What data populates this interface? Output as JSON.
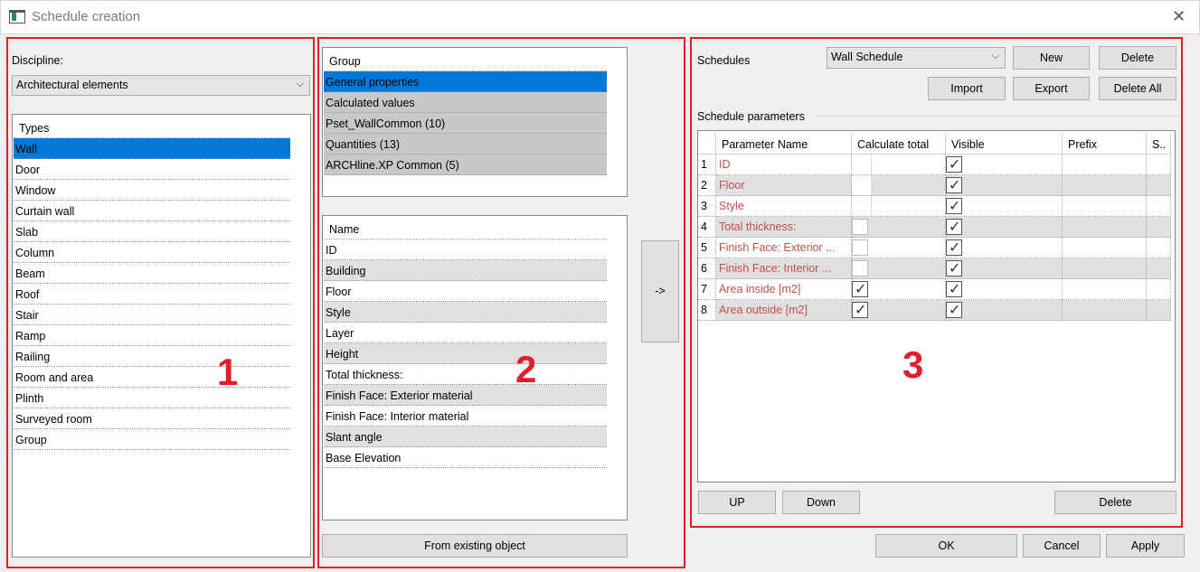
{
  "window": {
    "title": "Schedule creation"
  },
  "panel1": {
    "number": "1",
    "discipline_label": "Discipline:",
    "discipline_value": "Architectural elements",
    "types_header": "Types",
    "types": [
      "Wall",
      "Door",
      "Window",
      "Curtain wall",
      "Slab",
      "Column",
      "Beam",
      "Roof",
      "Stair",
      "Ramp",
      "Railing",
      "Room and area",
      "Plinth",
      "Surveyed room",
      "Group"
    ]
  },
  "panel2": {
    "number": "2",
    "group_header": "Group",
    "groups": [
      "General properties",
      "Calculated values",
      "Pset_WallCommon (10)",
      "Quantities (13)",
      "ARCHline.XP Common (5)"
    ],
    "name_header": "Name",
    "names": [
      "ID",
      "Building",
      "Floor",
      "Style",
      "Layer",
      "Height",
      "Total thickness:",
      "Finish Face: Exterior material",
      "Finish Face: Interior material",
      "Slant angle",
      "Base Elevation"
    ],
    "add_label": "->",
    "from_existing_label": "From existing object"
  },
  "panel3": {
    "number": "3",
    "schedules_label": "Schedules",
    "schedule_value": "Wall Schedule",
    "new_label": "New",
    "delete_label": "Delete",
    "import_label": "Import",
    "export_label": "Export",
    "delete_all_label": "Delete All",
    "params_label": "Schedule parameters",
    "columns": [
      "Parameter Name",
      "Calculate total",
      "Visible",
      "Prefix",
      "S.."
    ],
    "rows": [
      {
        "num": "1",
        "name": "ID",
        "total": "none",
        "visible": true
      },
      {
        "num": "2",
        "name": "Floor",
        "total": "none",
        "visible": true
      },
      {
        "num": "3",
        "name": "Style",
        "total": "none",
        "visible": true
      },
      {
        "num": "4",
        "name": "Total thickness:",
        "total": "empty",
        "visible": true
      },
      {
        "num": "5",
        "name": "Finish Face: Exterior ...",
        "total": "empty",
        "visible": true
      },
      {
        "num": "6",
        "name": "Finish Face: Interior ...",
        "total": "empty",
        "visible": true
      },
      {
        "num": "7",
        "name": "Area inside [m2]",
        "total": "checked",
        "visible": true
      },
      {
        "num": "8",
        "name": "Area outside [m2]",
        "total": "checked",
        "visible": true
      }
    ],
    "up_label": "UP",
    "down_label": "Down",
    "row_delete_label": "Delete"
  },
  "footer": {
    "ok_label": "OK",
    "cancel_label": "Cancel",
    "apply_label": "Apply"
  },
  "colors": {
    "selection": "#0078d7",
    "annotation_red": "#e41d2a",
    "param_text": "#c0504d"
  }
}
